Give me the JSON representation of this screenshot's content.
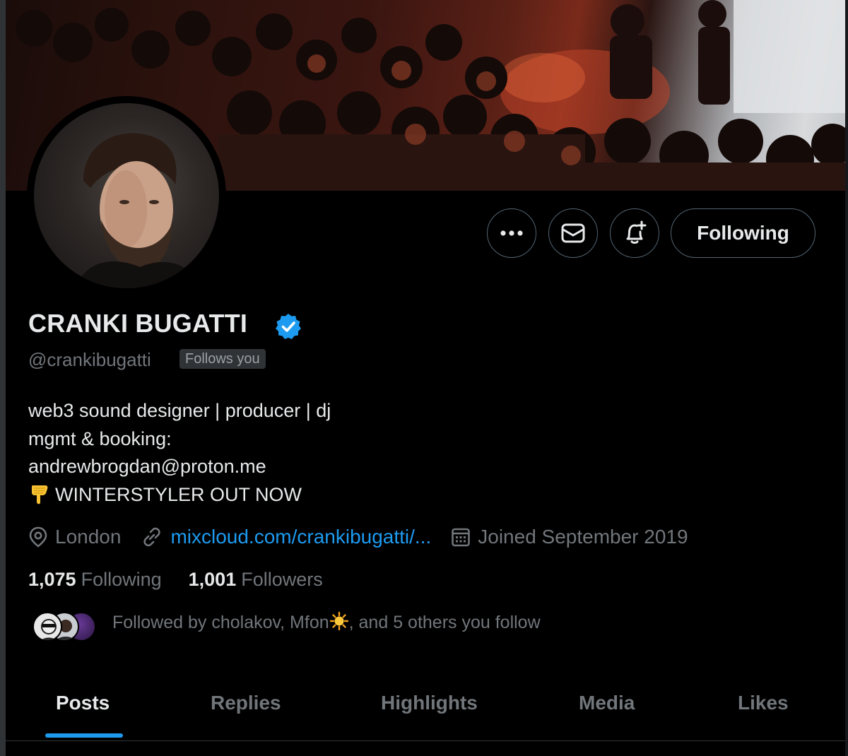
{
  "profile": {
    "display_name": "CRANKI BUGATTI",
    "handle": "@crankibugatti",
    "follows_you_badge": "Follows you",
    "bio": {
      "line1": "web3 sound designer | producer | dj",
      "line2": "mgmt & booking:",
      "line3": "andrewbrogdan@proton.me",
      "line4": "WINTERSTYLER OUT NOW",
      "line4_icon": "backhand-index-pointing-down-emoji"
    },
    "location": "London",
    "website": "mixcloud.com/crankibugatti/...",
    "joined": "Joined September 2019",
    "following_count": "1,075",
    "following_label": "Following",
    "followers_count": "1,001",
    "followers_label": "Followers",
    "followed_by": {
      "prefix": "Followed by cholakov, Mfon",
      "icon": "sun-emoji",
      "suffix": ", and 5 others you follow"
    }
  },
  "actions": {
    "more_icon": "more-dots-icon",
    "message_icon": "envelope-icon",
    "notify_icon": "bell-plus-icon",
    "follow_button_label": "Following"
  },
  "tabs": [
    {
      "label": "Posts",
      "active": true
    },
    {
      "label": "Replies",
      "active": false
    },
    {
      "label": "Highlights",
      "active": false
    },
    {
      "label": "Media",
      "active": false
    },
    {
      "label": "Likes",
      "active": false
    }
  ],
  "colors": {
    "background": "#000000",
    "accent": "#1d9bf0",
    "text_primary": "#e7e9ea",
    "text_secondary": "#71767b",
    "border": "#536471"
  }
}
